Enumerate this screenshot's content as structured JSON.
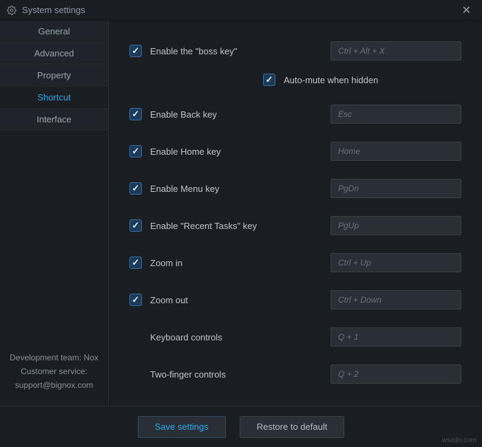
{
  "titlebar": {
    "title": "System settings"
  },
  "sidebar": {
    "items": [
      {
        "label": "General"
      },
      {
        "label": "Advanced"
      },
      {
        "label": "Property"
      },
      {
        "label": "Shortcut"
      },
      {
        "label": "Interface"
      }
    ],
    "active_index": 3,
    "footer_line1": "Development team: Nox",
    "footer_line2": "Customer service:",
    "footer_line3": "support@bignox.com"
  },
  "settings": {
    "boss_key": {
      "label": "Enable the \"boss key\"",
      "checked": true,
      "hotkey": "Ctrl + Alt + X"
    },
    "auto_mute": {
      "label": "Auto-mute when hidden",
      "checked": true
    },
    "back_key": {
      "label": "Enable Back key",
      "checked": true,
      "hotkey": "Esc"
    },
    "home_key": {
      "label": "Enable Home key",
      "checked": true,
      "hotkey": "Home"
    },
    "menu_key": {
      "label": "Enable Menu key",
      "checked": true,
      "hotkey": "PgDn"
    },
    "recent_tasks": {
      "label": "Enable \"Recent Tasks\" key",
      "checked": true,
      "hotkey": "PgUp"
    },
    "zoom_in": {
      "label": "Zoom in",
      "checked": true,
      "hotkey": "Ctrl + Up"
    },
    "zoom_out": {
      "label": "Zoom out",
      "checked": true,
      "hotkey": "Ctrl + Down"
    },
    "keyboard_controls": {
      "label": "Keyboard controls",
      "hotkey": "Q + 1"
    },
    "twofinger_controls": {
      "label": "Two-finger controls",
      "hotkey": "Q + 2"
    }
  },
  "footer": {
    "save": "Save settings",
    "restore": "Restore to default"
  },
  "watermark": "wsxdn.com"
}
